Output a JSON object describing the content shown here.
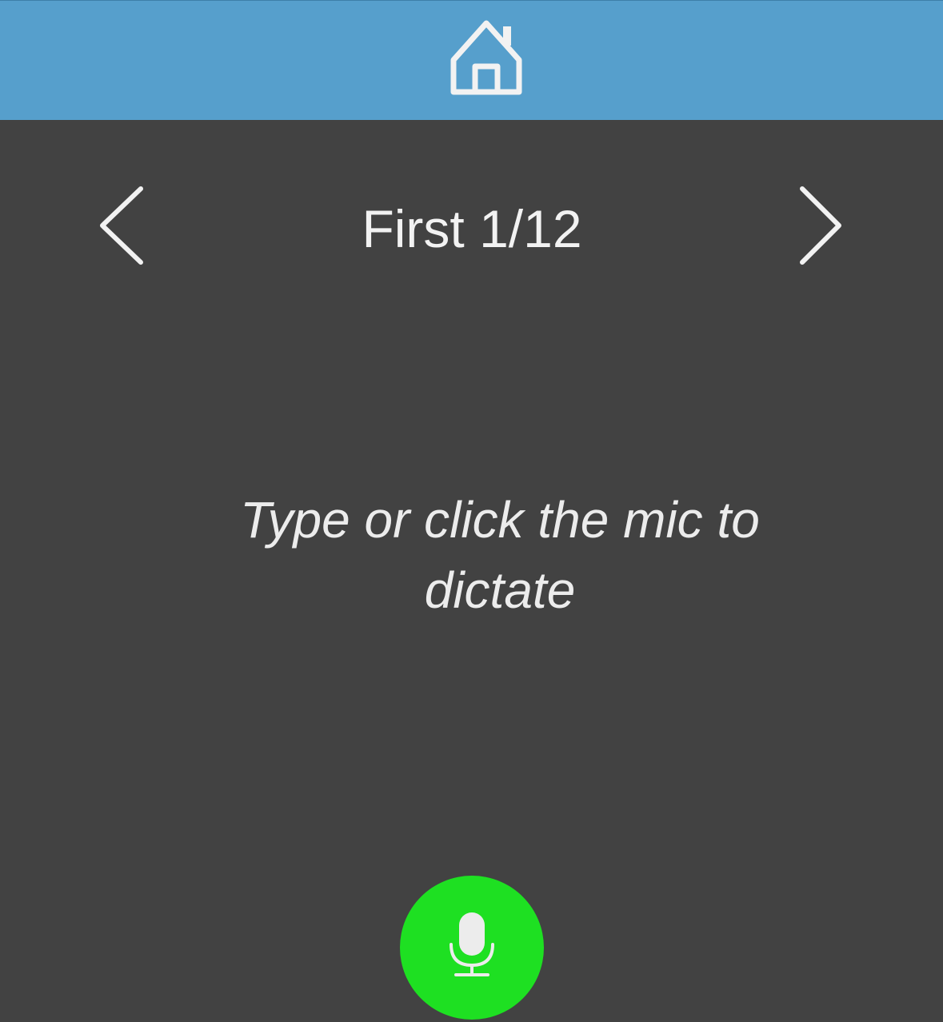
{
  "header": {
    "home_icon": "home-icon",
    "color": "#569fcc"
  },
  "navigation": {
    "prev_icon": "chevron-left-icon",
    "next_icon": "chevron-right-icon",
    "title": "First 1/12"
  },
  "editor": {
    "placeholder": "Type or click the mic to dictate"
  },
  "mic": {
    "icon": "microphone-icon",
    "color": "#1ee022"
  },
  "colors": {
    "background": "#424242",
    "text": "#f2f2f2"
  }
}
